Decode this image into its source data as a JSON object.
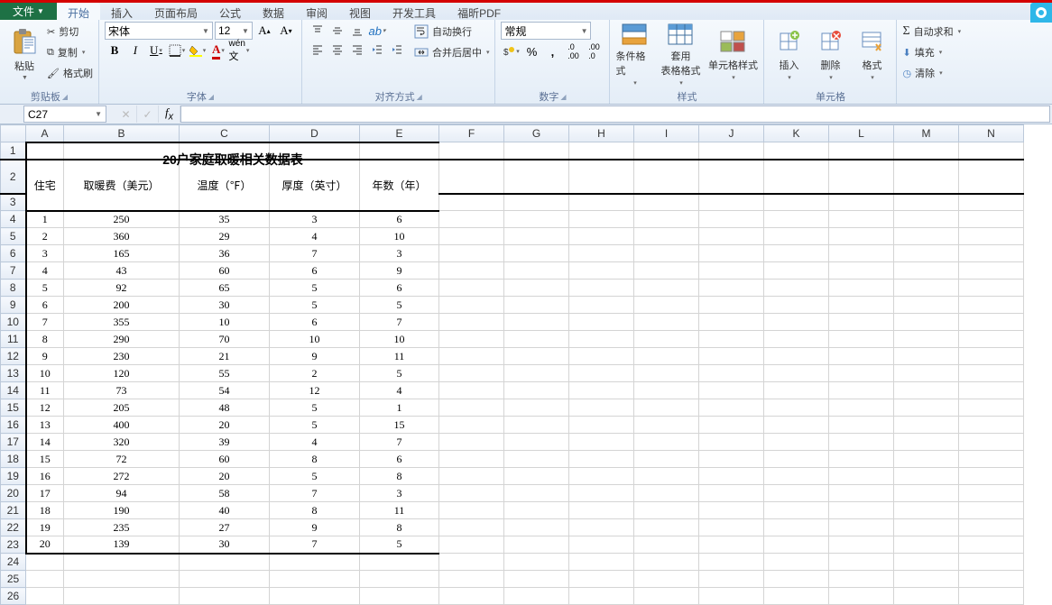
{
  "tabs": {
    "file": "文件",
    "start": "开始",
    "insert": "插入",
    "layout": "页面布局",
    "formula": "公式",
    "data": "数据",
    "review": "审阅",
    "view": "视图",
    "dev": "开发工具",
    "pdf": "福昕PDF"
  },
  "clipboard": {
    "paste": "粘贴",
    "cut": "剪切",
    "copy": "复制",
    "painter": "格式刷",
    "group": "剪贴板"
  },
  "font": {
    "name": "宋体",
    "size": "12",
    "group": "字体"
  },
  "align": {
    "wrap": "自动换行",
    "merge": "合并后居中",
    "group": "对齐方式"
  },
  "number": {
    "format": "常规",
    "group": "数字"
  },
  "styles": {
    "cond": "条件格式",
    "table": "套用\n表格格式",
    "cell": "单元格样式",
    "group": "样式"
  },
  "cells": {
    "insert": "插入",
    "delete": "删除",
    "format": "格式",
    "group": "单元格"
  },
  "edit": {
    "sum": "自动求和",
    "fill": "填充",
    "clear": "清除"
  },
  "name_box": "C27",
  "sheet": {
    "title": "20户家庭取暖相关数据表",
    "headers": [
      "住宅",
      "取暖费（美元）",
      "温度（℉）",
      "厚度（英寸）",
      "年数（年）"
    ],
    "cols": [
      "A",
      "B",
      "C",
      "D",
      "E",
      "F",
      "G",
      "H",
      "I",
      "J",
      "K",
      "L",
      "M",
      "N"
    ],
    "rownums": [
      1,
      2,
      3,
      4,
      5,
      6,
      7,
      8,
      9,
      10,
      11,
      12,
      13,
      14,
      15,
      16,
      17,
      18,
      19,
      20,
      21,
      22,
      23,
      24,
      25,
      26
    ],
    "rows": [
      [
        1,
        250,
        35,
        3,
        6
      ],
      [
        2,
        360,
        29,
        4,
        10
      ],
      [
        3,
        165,
        36,
        7,
        3
      ],
      [
        4,
        43,
        60,
        6,
        9
      ],
      [
        5,
        92,
        65,
        5,
        6
      ],
      [
        6,
        200,
        30,
        5,
        5
      ],
      [
        7,
        355,
        10,
        6,
        7
      ],
      [
        8,
        290,
        70,
        10,
        10
      ],
      [
        9,
        230,
        21,
        9,
        11
      ],
      [
        10,
        120,
        55,
        2,
        5
      ],
      [
        11,
        73,
        54,
        12,
        4
      ],
      [
        12,
        205,
        48,
        5,
        1
      ],
      [
        13,
        400,
        20,
        5,
        15
      ],
      [
        14,
        320,
        39,
        4,
        7
      ],
      [
        15,
        72,
        60,
        8,
        6
      ],
      [
        16,
        272,
        20,
        5,
        8
      ],
      [
        17,
        94,
        58,
        7,
        3
      ],
      [
        18,
        190,
        40,
        8,
        11
      ],
      [
        19,
        235,
        27,
        9,
        8
      ],
      [
        20,
        139,
        30,
        7,
        5
      ]
    ]
  },
  "chart_data": {
    "type": "table",
    "title": "20户家庭取暖相关数据表",
    "columns": [
      "住宅",
      "取暖费（美元）",
      "温度（℉）",
      "厚度（英寸）",
      "年数（年）"
    ],
    "data": [
      [
        1,
        250,
        35,
        3,
        6
      ],
      [
        2,
        360,
        29,
        4,
        10
      ],
      [
        3,
        165,
        36,
        7,
        3
      ],
      [
        4,
        43,
        60,
        6,
        9
      ],
      [
        5,
        92,
        65,
        5,
        6
      ],
      [
        6,
        200,
        30,
        5,
        5
      ],
      [
        7,
        355,
        10,
        6,
        7
      ],
      [
        8,
        290,
        70,
        10,
        10
      ],
      [
        9,
        230,
        21,
        9,
        11
      ],
      [
        10,
        120,
        55,
        2,
        5
      ],
      [
        11,
        73,
        54,
        12,
        4
      ],
      [
        12,
        205,
        48,
        5,
        1
      ],
      [
        13,
        400,
        20,
        5,
        15
      ],
      [
        14,
        320,
        39,
        4,
        7
      ],
      [
        15,
        72,
        60,
        8,
        6
      ],
      [
        16,
        272,
        20,
        5,
        8
      ],
      [
        17,
        94,
        58,
        7,
        3
      ],
      [
        18,
        190,
        40,
        8,
        11
      ],
      [
        19,
        235,
        27,
        9,
        8
      ],
      [
        20,
        139,
        30,
        7,
        5
      ]
    ]
  }
}
